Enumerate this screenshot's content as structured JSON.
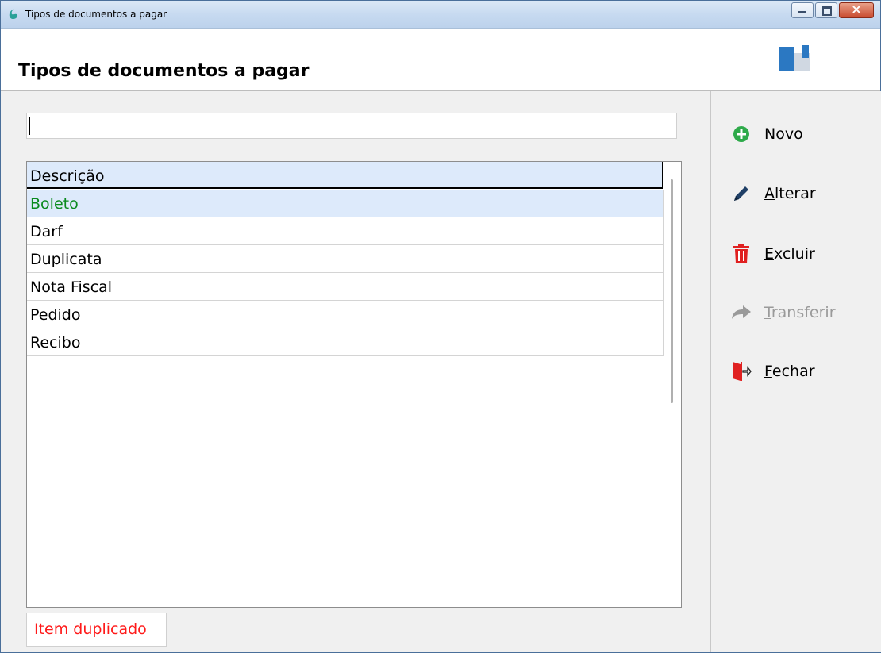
{
  "window": {
    "title": "Tipos de documentos a pagar"
  },
  "header": {
    "title": "Tipos de documentos a pagar"
  },
  "search": {
    "value": ""
  },
  "grid": {
    "column_header": "Descrição",
    "rows": [
      "Boleto",
      "Darf",
      "Duplicata",
      "Nota Fiscal",
      "Pedido",
      "Recibo"
    ],
    "selected_index": 0
  },
  "status": {
    "text": "Item duplicado",
    "color": "#ff1a1a"
  },
  "actions": [
    {
      "accel": "N",
      "rest": "ovo",
      "icon": "plus-circle-icon",
      "enabled": true
    },
    {
      "accel": "A",
      "rest": "lterar",
      "icon": "pencil-icon",
      "enabled": true
    },
    {
      "accel": "E",
      "rest": "xcluir",
      "icon": "trash-icon",
      "enabled": true
    },
    {
      "accel": "T",
      "rest": "ransferir",
      "icon": "forward-arrow-icon",
      "enabled": false
    },
    {
      "accel": "F",
      "rest": "echar",
      "icon": "exit-door-icon",
      "enabled": true
    }
  ],
  "colors": {
    "selected_row_bg": "#ddeafb",
    "selected_row_text": "#0a8a1e",
    "accent_green": "#2eaa4a",
    "accent_red": "#e02020",
    "pencil_blue": "#1f3f66"
  }
}
